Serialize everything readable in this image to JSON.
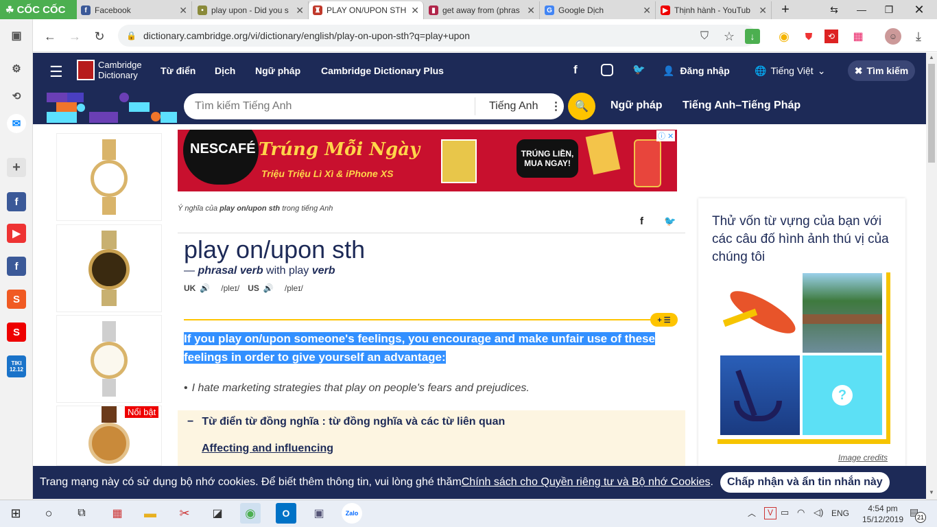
{
  "browser": {
    "brand": "CỐC CỐC",
    "tabs": [
      {
        "label": "Facebook",
        "icon": "facebook-icon",
        "color": "#3b5998"
      },
      {
        "label": "play upon - Did you s",
        "icon": "flag-icon",
        "color": "#8a8a3a"
      },
      {
        "label": "PLAY ON/UPON STH",
        "icon": "cambridge-icon",
        "color": "#c0392b",
        "active": true
      },
      {
        "label": "get away from (phras",
        "icon": "book-icon",
        "color": "#b0254a"
      },
      {
        "label": "Google Dịch",
        "icon": "translate-icon",
        "color": "#4285f4"
      },
      {
        "label": "Thịnh hành - YouTub",
        "icon": "youtube-icon",
        "color": "#e00"
      }
    ],
    "new_tab": "+",
    "url": "dictionary.cambridge.org/vi/dictionary/english/play-on-upon-sth?q=play+upon"
  },
  "nav": {
    "logo_line1": "Cambridge",
    "logo_line2": "Dictionary",
    "items": [
      "Từ điển",
      "Dịch",
      "Ngữ pháp",
      "Cambridge Dictionary Plus"
    ],
    "login": "Đăng nhập",
    "language": "Tiếng Việt",
    "search_btn": "Tìm kiếm"
  },
  "search": {
    "placeholder": "Tìm kiếm Tiếng Anh",
    "dict": "Tiếng Anh",
    "links": [
      "Ngữ pháp",
      "Tiếng Anh–Tiếng Pháp"
    ]
  },
  "banner": {
    "brand": "NESCAFÉ",
    "headline": "Trúng Mỗi Ngày",
    "sub": "Triệu Triệu Lì Xì & iPhone XS",
    "cta": "TRÚNG LIỀN, MUA NGAY!"
  },
  "entry": {
    "breadcrumb_pre": "Ý nghĩa của ",
    "breadcrumb_word": "play on/upon sth",
    "breadcrumb_post": " trong tiếng Anh",
    "headword": "play on/upon sth",
    "pos_dash": "— ",
    "pos": "phrasal verb",
    "pos_with": " with play ",
    "pos2": "verb",
    "uk": "UK",
    "uk_ipa": "/pleɪ/",
    "us": "US",
    "us_ipa": "/pleɪ/",
    "definition": "If you play on/upon someone's feelings, you encourage and make unfair use of these feelings in order to give yourself an advantage:",
    "example": "I hate marketing strategies that play on people's fears and prejudices.",
    "thesaurus_title": "Từ điển từ đồng nghĩa : từ đồng nghĩa và các từ liên quan",
    "thesaurus_link": "Affecting and influencing",
    "plus_badge": "+ ☰"
  },
  "quiz": {
    "title": "Thử vốn từ vựng của bạn với các câu đố hình ảnh thú vị của chúng tôi",
    "credits": "Image credits"
  },
  "left_ads": {
    "badge": "Nổi bật"
  },
  "cookie": {
    "text": "Trang mạng này có sử dụng bộ nhớ cookies. Để biết thêm thông tin, vui lòng ghé thăm ",
    "link": "Chính sách cho Quyền riêng tư và Bộ nhớ Cookies",
    "dot": ".",
    "button": "Chấp nhận và ẩn tin nhắn này"
  },
  "taskbar": {
    "lang": "ENG",
    "time": "4:54 pm",
    "date": "15/12/2019",
    "notif": "21"
  },
  "sidebar": {
    "tiki": "TIKI 12.12"
  }
}
